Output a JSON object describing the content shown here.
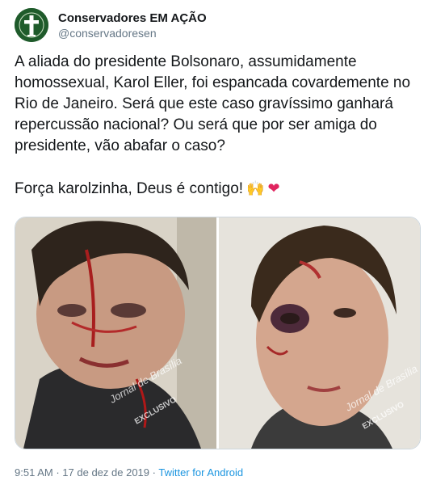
{
  "account": {
    "display_name": "Conservadores EM AÇÃO",
    "handle": "@conservadoresen"
  },
  "tweet": {
    "text": "A aliada do presidente Bolsonaro, assumidamente homossexual, Karol Eller, foi espancada covardemente no Rio de Janeiro. Será que este caso gravíssimo ganhará repercussão nacional? Ou será que por ser amiga do presidente, vão abafar o caso?",
    "text2": "Força karolzinha, Deus é contigo!",
    "emoji_hands": "🙌",
    "emoji_heart": "❤"
  },
  "media": {
    "watermark": "Jornal de Brasília",
    "watermark_tag": "EXCLUSIVO"
  },
  "footer": {
    "time": "9:51 AM",
    "date": "17 de dez de 2019",
    "separator": "·",
    "source": "Twitter for Android"
  },
  "colors": {
    "avatar_bg": "#1f5b2b",
    "link": "#1b95e0",
    "meta_gray": "#657786",
    "heart": "#e0245e"
  },
  "icons": [
    "cross-logo-icon"
  ]
}
